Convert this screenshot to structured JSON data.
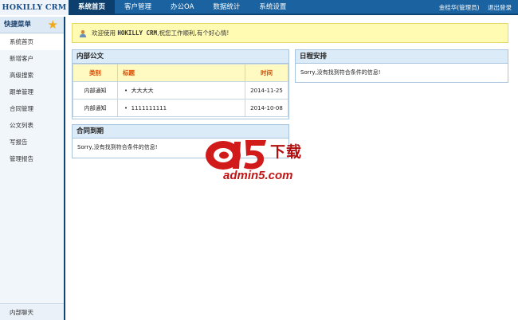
{
  "app": {
    "logo": "HOKILLY CRM"
  },
  "nav": {
    "items": [
      {
        "label": "系统首页",
        "active": true
      },
      {
        "label": "客户管理",
        "active": false
      },
      {
        "label": "办公OA",
        "active": false
      },
      {
        "label": "数据统计",
        "active": false
      },
      {
        "label": "系统设置",
        "active": false
      }
    ]
  },
  "user": {
    "name": "金桂华(管理员)",
    "logout": "退出登录"
  },
  "sidebar": {
    "title": "快捷菜单",
    "star_icon": "star-icon",
    "items": [
      {
        "label": "系统首页",
        "active": true
      },
      {
        "label": "新增客户"
      },
      {
        "label": "高级搜索"
      },
      {
        "label": "跟单管理"
      },
      {
        "label": "合同管理"
      },
      {
        "label": "公文列表"
      },
      {
        "label": "写报告"
      },
      {
        "label": "管理报告"
      }
    ],
    "bottom": "内部聊天"
  },
  "welcome": {
    "icon": "user-icon",
    "prefix": "欢迎使用",
    "product": "HOKILLY CRM",
    "suffix": ",祝您工作顺利,有个好心情!"
  },
  "docs": {
    "title": "内部公文",
    "columns": [
      "类别",
      "标题",
      "时间"
    ],
    "rows": [
      {
        "type": "内部通知",
        "title": "大大大大",
        "time": "2014-11-25"
      },
      {
        "type": "内部通知",
        "title": "1111111111",
        "time": "2014-10-08"
      }
    ]
  },
  "contract": {
    "title": "合同到期",
    "empty": "Sorry,没有找到符合条件的信息!"
  },
  "schedule": {
    "title": "日程安排",
    "empty": "Sorry,没有找到符合条件的信息!"
  },
  "watermark": {
    "brand": "下载",
    "url": "admin5.com",
    "logo_text": "a5"
  },
  "colors": {
    "topbar": "#1a62a0",
    "nav_active": "#0c3f6e",
    "welcome_bg": "#fffbb3",
    "panel_head": "#dcebf8",
    "table_head_text": "#d64a00",
    "watermark": "#c01515"
  }
}
